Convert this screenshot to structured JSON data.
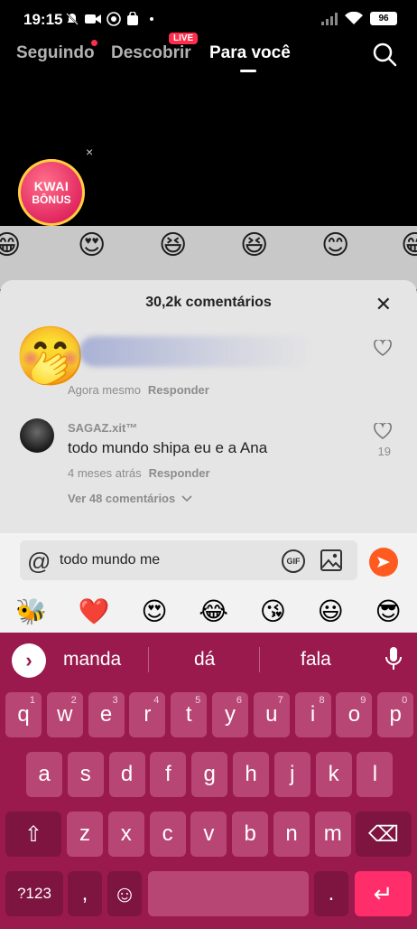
{
  "status": {
    "time": "19:15",
    "battery": "96"
  },
  "nav": {
    "tabs": [
      "Seguindo",
      "Descobrir",
      "Para você"
    ],
    "live_badge": "LIVE"
  },
  "bonus": {
    "line1": "KWAI",
    "line2": "BÔNUS",
    "close": "×"
  },
  "background_emojis": [
    "😁",
    "😍",
    "😆",
    "😆",
    "😊",
    "😁"
  ],
  "comments": {
    "title": "30,2k comentários",
    "close": "✕",
    "items": [
      {
        "emoji": "🤭",
        "time": "Agora mesmo",
        "reply": "Responder"
      },
      {
        "user": "SAGAZ.xit™",
        "text": "todo mundo shipa eu e a Ana",
        "time": "4 meses atrás",
        "reply": "Responder",
        "likes": "19"
      }
    ],
    "see_more": "Ver 48 comentários"
  },
  "input": {
    "at": "@",
    "value": "todo mundo me",
    "gif": "GIF"
  },
  "quick_emojis": [
    "🐝",
    "❤️",
    "😍",
    "😂",
    "😘",
    "😃",
    "😎"
  ],
  "keyboard": {
    "suggestions": [
      "manda",
      "dá",
      "fala"
    ],
    "expand": "›",
    "row1": [
      [
        "q",
        "1"
      ],
      [
        "w",
        "2"
      ],
      [
        "e",
        "3"
      ],
      [
        "r",
        "4"
      ],
      [
        "t",
        "5"
      ],
      [
        "y",
        "6"
      ],
      [
        "u",
        "7"
      ],
      [
        "i",
        "8"
      ],
      [
        "o",
        "9"
      ],
      [
        "p",
        "0"
      ]
    ],
    "row2": [
      "a",
      "s",
      "d",
      "f",
      "g",
      "h",
      "j",
      "k",
      "l"
    ],
    "row3": [
      "z",
      "x",
      "c",
      "v",
      "b",
      "n",
      "m"
    ],
    "sym": "?123",
    "comma": ",",
    "period": ".",
    "enter": "↵",
    "shift": "⇧",
    "backspace": "⌫",
    "emoji": "☺"
  }
}
